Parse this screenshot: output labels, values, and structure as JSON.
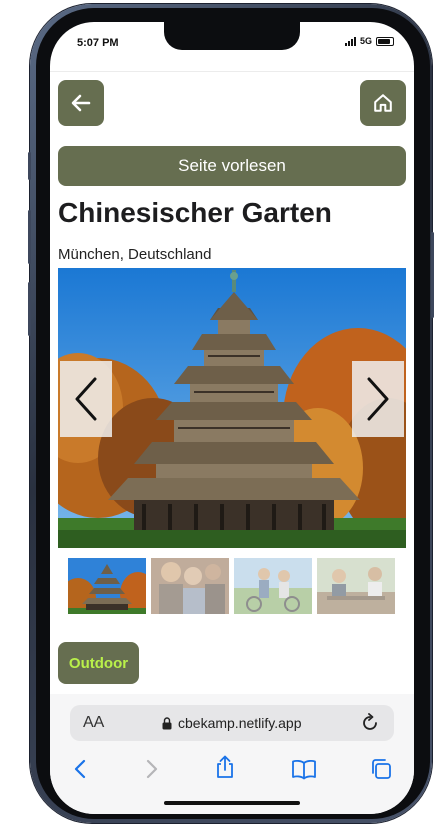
{
  "status": {
    "time": "5:07 PM",
    "network": "5G"
  },
  "page": {
    "read_aloud_label": "Seite vorlesen",
    "title": "Chinesischer Garten",
    "location": "München, Deutschland",
    "tag": "Outdoor"
  },
  "nav": {
    "back_icon": "arrow-left-icon",
    "home_icon": "home-icon"
  },
  "carousel": {
    "prev_icon": "chevron-left-icon",
    "next_icon": "chevron-right-icon",
    "thumbnail_count": 4,
    "active_index": 0
  },
  "browser": {
    "text_size_label": "AA",
    "url": "cbekamp.netlify.app",
    "lock_icon": "lock-icon",
    "reload_icon": "reload-icon",
    "toolbar": [
      "back-icon",
      "forward-icon",
      "share-icon",
      "bookmarks-icon",
      "tabs-icon"
    ]
  },
  "colors": {
    "brand": "#666e50",
    "tag_text": "#b9f04a",
    "ios_blue": "#1a73e8"
  }
}
